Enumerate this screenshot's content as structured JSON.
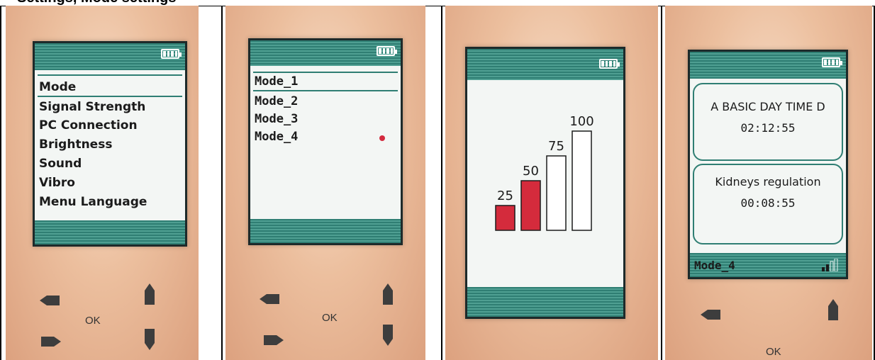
{
  "page_header": {
    "text": "Settings, Mode settings"
  },
  "panel1": {
    "menu": [
      "Mode",
      "Signal Strength",
      "PC Connection",
      "Brightness",
      "Sound",
      "Vibro",
      "Menu Language"
    ],
    "selected": "Mode",
    "ok_label": "OK"
  },
  "panel2": {
    "modes": [
      "Mode_1",
      "Mode_2",
      "Mode_3",
      "Mode_4"
    ],
    "selected": "Mode_1",
    "active_indicator": "Mode_4",
    "ok_label": "OK"
  },
  "panel3": {
    "chart_data": {
      "type": "bar",
      "categories": [
        "25",
        "50",
        "75",
        "100"
      ],
      "values": [
        25,
        50,
        75,
        100
      ],
      "active_level": 50,
      "ylim": [
        0,
        100
      ],
      "fill_active": "#d42b3c",
      "fill_inactive": "#ffffff"
    }
  },
  "panel4": {
    "sessions": [
      {
        "title": "A BASIC DAY TIME D",
        "time": "02:12:55"
      },
      {
        "title": "Kidneys regulation",
        "time": "00:08:55"
      }
    ],
    "footer_mode": "Mode_4",
    "ok_label": "OK"
  },
  "colors": {
    "bar_teal": "#2f7e73",
    "accent_red": "#d32a3e",
    "screen_bg": "#f3f6f4",
    "device_body": "#ecbf9e"
  },
  "icons": [
    "battery-icon",
    "signal-icon",
    "left-arrow-key-icon",
    "right-arrow-key-icon",
    "up-arrow-key-icon",
    "down-arrow-key-icon"
  ]
}
